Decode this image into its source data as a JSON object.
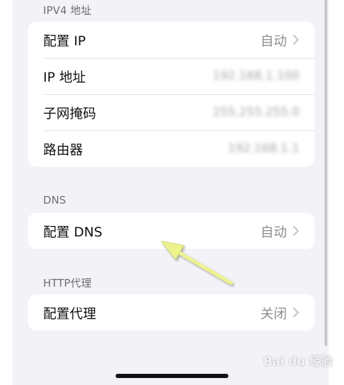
{
  "sections": {
    "ipv4": {
      "header": "IPV4 地址",
      "rows": [
        {
          "label": "配置 IP",
          "value": "自动"
        },
        {
          "label": "IP 地址",
          "value": "192.168.1.100"
        },
        {
          "label": "子网掩码",
          "value": "255.255.255.0"
        },
        {
          "label": "路由器",
          "value": "192.168.1.1"
        }
      ]
    },
    "dns": {
      "header": "DNS",
      "rows": [
        {
          "label": "配置 DNS",
          "value": "自动"
        }
      ]
    },
    "http_proxy": {
      "header": "HTTP代理",
      "rows": [
        {
          "label": "配置代理",
          "value": "关闭"
        }
      ]
    }
  },
  "watermark": "Bai du 经验",
  "icons": {
    "chevron": "chevron-right-icon",
    "annotation": "yellow-arrow-icon"
  },
  "colors": {
    "background": "#f2f2f7",
    "card": "#ffffff",
    "arrow": "#eef28c"
  }
}
